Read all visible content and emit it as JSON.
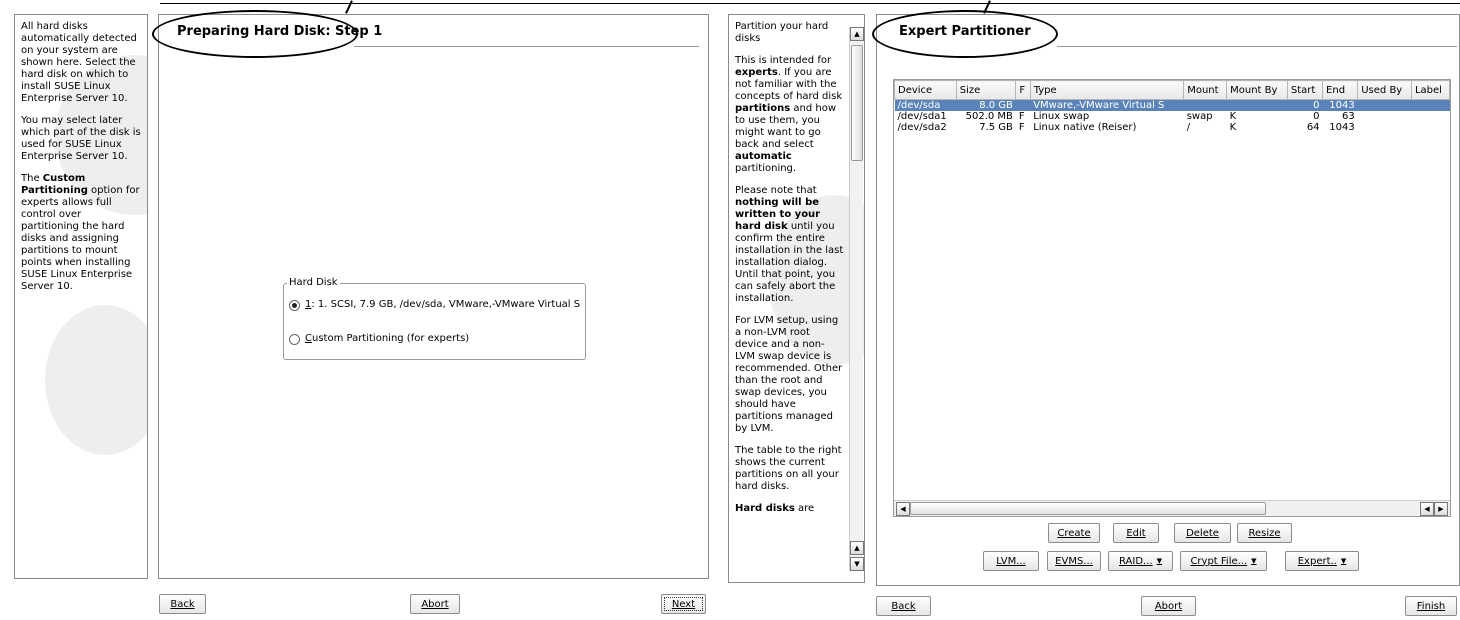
{
  "left": {
    "help": [
      "All hard disks automatically detected on your system are shown here. Select the hard disk on which to install SUSE Linux Enterprise Server 10.",
      "You may select later which part of the disk is used for SUSE Linux Enterprise Server 10.",
      {
        "bold": "Custom Partitioning",
        "pre": "The ",
        "post": " option for experts allows full control over partitioning the hard disks and assigning partitions to mount points when installing SUSE Linux Enterprise Server 10."
      }
    ],
    "title": "Preparing Hard Disk: Step 1",
    "group_label": "Hard Disk",
    "radio1_key": "1",
    "radio1_text": ":  1. SCSI,   7.9 GB, /dev/sda, VMware,-VMware Virtual S",
    "radio2_key": "C",
    "radio2_text": "ustom Partitioning (for experts)",
    "buttons": {
      "back": "Back",
      "abort": "Abort",
      "next": "Next"
    }
  },
  "right": {
    "help_html": "Partition your hard disks|This is intended for <b>experts</b>. If you are not familiar with the concepts of hard disk <b>partitions</b> and how to use them, you might want to go back and select <b>automatic</b> partitioning.|Please note that <b>nothing will be written to your hard disk</b> until you confirm the entire installation in the last installation dialog. Until that point, you can safely abort the installation.|For LVM setup, using a non-LVM root device and a non-LVM swap device is recommended. Other than the root and swap devices, you should have partitions managed by LVM.|The table to the right shows the current partitions on all your hard disks.|<b>Hard disks</b> are",
    "title": "Expert Partitioner",
    "columns": [
      "Device",
      "Size",
      "F",
      "Type",
      "Mount",
      "Mount By",
      "Start",
      "End",
      "Used By",
      "Label"
    ],
    "rows": [
      [
        "/dev/sda",
        "8.0 GB",
        "",
        "VMware,-VMware Virtual S",
        "",
        "",
        "0",
        "1043",
        "",
        ""
      ],
      [
        "/dev/sda1",
        "502.0 MB",
        "F",
        "Linux swap",
        "swap",
        "K",
        "0",
        "63",
        "",
        ""
      ],
      [
        "/dev/sda2",
        "7.5 GB",
        "F",
        "Linux native (Reiser)",
        "/",
        "K",
        "64",
        "1043",
        "",
        ""
      ]
    ],
    "buttons_row1": [
      "Create",
      "Edit",
      "Delete",
      "Resize"
    ],
    "buttons_row2": [
      "LVM...",
      "EVMS...",
      "RAID...",
      "Crypt File...",
      "Expert.."
    ],
    "buttons": {
      "back": "Back",
      "abort": "Abort",
      "finish": "Finish"
    }
  }
}
